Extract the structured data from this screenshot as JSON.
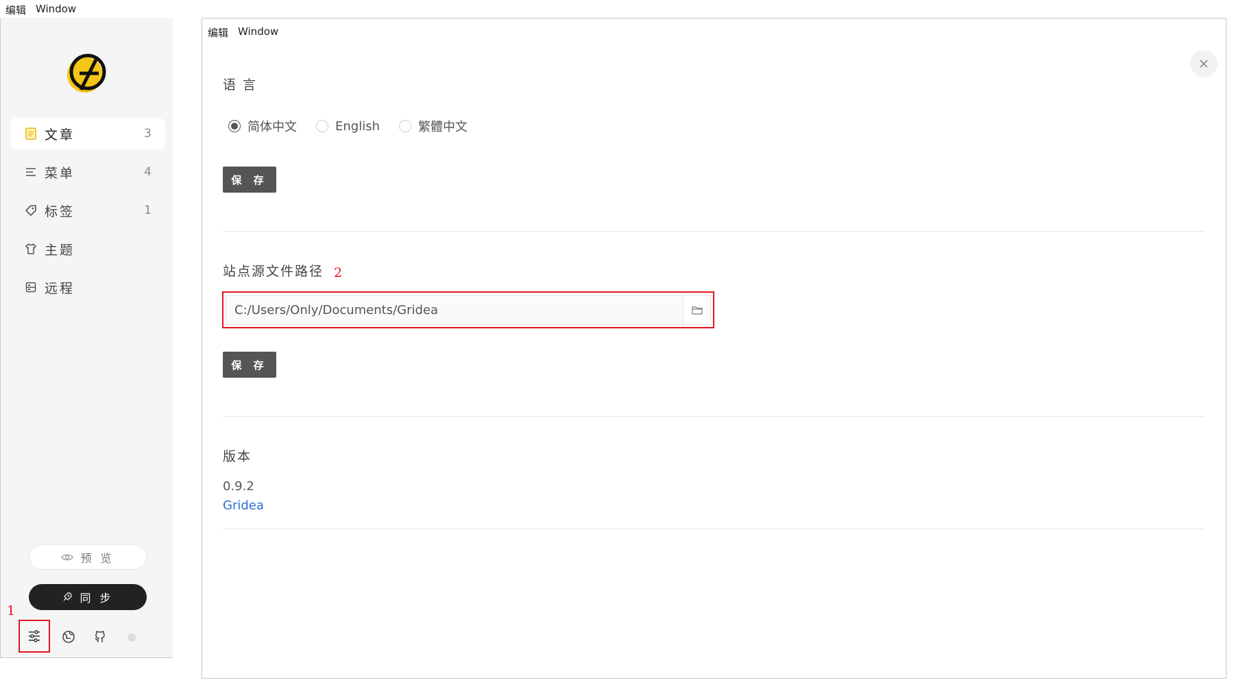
{
  "top_menu": {
    "edit": "编辑",
    "window": "Window"
  },
  "inner_menu": {
    "edit": "编辑",
    "window": "Window"
  },
  "sidebar": {
    "items": [
      {
        "label": "文章",
        "count": "3",
        "icon": "document-icon"
      },
      {
        "label": "菜单",
        "count": "4",
        "icon": "menu-icon"
      },
      {
        "label": "标签",
        "count": "1",
        "icon": "tag-icon"
      },
      {
        "label": "主题",
        "count": "",
        "icon": "shirt-icon"
      },
      {
        "label": "远程",
        "count": "",
        "icon": "server-icon"
      }
    ],
    "preview_label": "预 览",
    "sync_label": "同 步",
    "footer_icons": [
      "settings-icon",
      "globe-icon",
      "github-icon"
    ]
  },
  "annotations": {
    "one": "1",
    "two": "2"
  },
  "settings": {
    "language_title": "语 言",
    "languages": [
      "简体中文",
      "English",
      "繁體中文"
    ],
    "selected_language": "简体中文",
    "save_label": "保 存",
    "source_path_title": "站点源文件路径",
    "source_path_value": "C:/Users/Only/Documents/Gridea",
    "version_title": "版本",
    "version_number": "0.9.2",
    "app_link": "Gridea"
  },
  "colors": {
    "accent_logo": "#f5c518",
    "annotation_red": "#e0141e",
    "link_blue": "#2b6dd6",
    "sync_bg": "#222222"
  }
}
